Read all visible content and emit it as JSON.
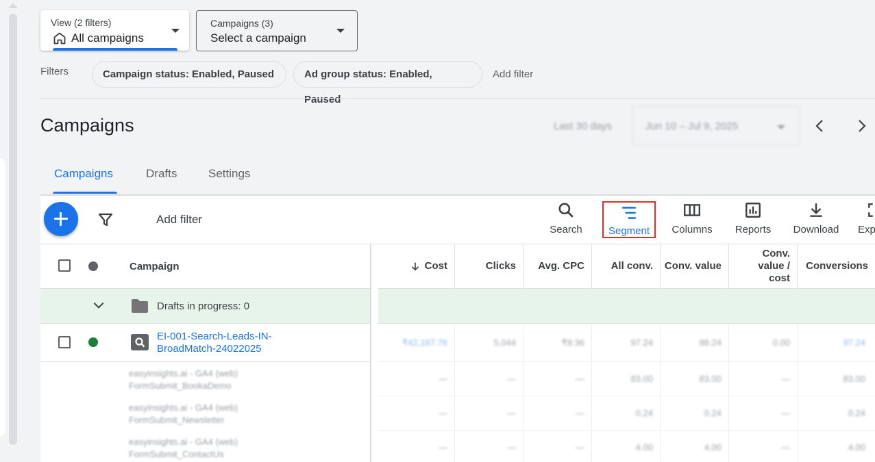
{
  "view_selector": {
    "label": "View (2 filters)",
    "value": "All campaigns"
  },
  "campaign_selector": {
    "label": "Campaigns (3)",
    "value": "Select a campaign"
  },
  "filters": {
    "label": "Filters",
    "chips": [
      "Campaign status: Enabled, Paused",
      "Ad group status: Enabled, Paused"
    ],
    "add_filter": "Add filter"
  },
  "page_title": "Campaigns",
  "date_range": {
    "preset": "Last 30 days",
    "range": "Jun 10 – Jul 9, 2025"
  },
  "tabs": [
    {
      "label": "Campaigns",
      "active": true
    },
    {
      "label": "Drafts",
      "active": false
    },
    {
      "label": "Settings",
      "active": false
    }
  ],
  "toolbar": {
    "add_filter": "Add filter",
    "tools": [
      {
        "label": "Search",
        "icon": "search-icon"
      },
      {
        "label": "Segment",
        "icon": "segment-icon",
        "highlighted": true
      },
      {
        "label": "Columns",
        "icon": "columns-icon"
      },
      {
        "label": "Reports",
        "icon": "reports-icon"
      },
      {
        "label": "Download",
        "icon": "download-icon"
      },
      {
        "label": "Exp",
        "icon": "expand-icon"
      }
    ]
  },
  "table": {
    "campaign_header": "Campaign",
    "metric_headers": [
      "Cost",
      "Clicks",
      "Avg. CPC",
      "All conv.",
      "Conv. value",
      "Conv. value / cost",
      "Conversions"
    ],
    "drafts_row": "Drafts in progress: 0",
    "campaign_row": {
      "name": "EI-001-Search-Leads-IN-BroadMatch-24022025",
      "name_line1": "EI-001-Search-Leads-IN-",
      "name_line2": "BroadMatch-24022025",
      "status": "enabled",
      "metrics": [
        "₹42,167.76",
        "5,044",
        "₹9.36",
        "97.24",
        "88.24",
        "0.00",
        "97.24"
      ]
    },
    "sub_rows": [
      {
        "line1": "easyinsights.ai - GA4 (web)",
        "line2": "FormSubmit_BookaDemo",
        "metrics": [
          "—",
          "—",
          "—",
          "83.00",
          "83.00",
          "—",
          "83.00"
        ]
      },
      {
        "line1": "easyinsights.ai - GA4 (web)",
        "line2": "FormSubmit_Newsletter",
        "metrics": [
          "—",
          "—",
          "—",
          "0.24",
          "0.24",
          "—",
          "0.24"
        ]
      },
      {
        "line1": "easyinsights.ai - GA4 (web)",
        "line2": "FormSubmit_ContactUs",
        "metrics": [
          "—",
          "—",
          "—",
          "4.00",
          "4.00",
          "—",
          "4.00"
        ]
      }
    ]
  },
  "colors": {
    "accent": "#1a73e8",
    "highlight_border": "#d93025",
    "enabled_dot": "#188038",
    "drafts_bg": "#e6f4ea"
  }
}
